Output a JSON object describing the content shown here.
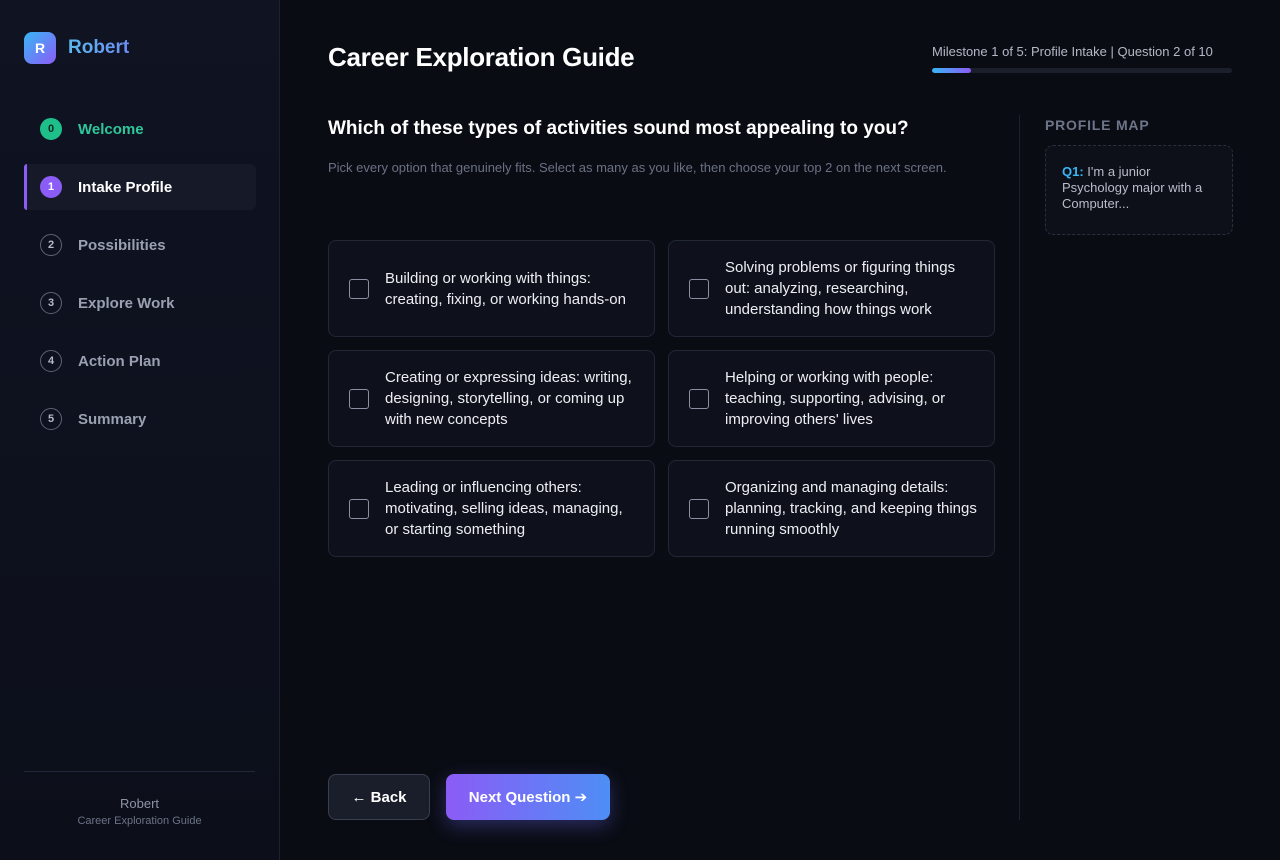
{
  "brand": {
    "logo_letter": "R",
    "name": "Robert"
  },
  "sidebar": {
    "items": [
      {
        "step": "0",
        "label": "Welcome",
        "state": "done"
      },
      {
        "step": "1",
        "label": "Intake Profile",
        "state": "active"
      },
      {
        "step": "2",
        "label": "Possibilities",
        "state": "pending"
      },
      {
        "step": "3",
        "label": "Explore Work",
        "state": "pending"
      },
      {
        "step": "4",
        "label": "Action Plan",
        "state": "pending"
      },
      {
        "step": "5",
        "label": "Summary",
        "state": "pending"
      }
    ],
    "footer": {
      "name": "Robert",
      "subtitle": "Career Exploration Guide"
    }
  },
  "header": {
    "title": "Career Exploration Guide",
    "progress_text": "Milestone 1 of 5: Profile Intake | Question 2 of 10",
    "progress_fraction": 0.13
  },
  "question": {
    "text": "Which of these types of activities sound most appealing to you?",
    "instructions": "Pick every option that genuinely fits. Select as many as you like, then choose your top 2 on the next screen.",
    "options": [
      {
        "label": "Building or working with things: creating, fixing, or working hands-on",
        "checked": false
      },
      {
        "label": "Solving problems or figuring things out: analyzing, researching, understanding how things work",
        "checked": false
      },
      {
        "label": "Creating or expressing ideas: writing, designing, storytelling, or coming up with new concepts",
        "checked": false
      },
      {
        "label": "Helping or working with people: teaching, supporting, advising, or improving others' lives",
        "checked": false
      },
      {
        "label": "Leading or influencing others: motivating, selling ideas, managing, or starting something",
        "checked": false
      },
      {
        "label": "Organizing and managing details: planning, tracking, and keeping things running smoothly",
        "checked": false
      }
    ]
  },
  "buttons": {
    "back": "← Back",
    "next": "Next Question ➔"
  },
  "profile_map": {
    "heading": "PROFILE MAP",
    "entries": [
      {
        "q": "Q1:",
        "answer": "I'm a junior Psychology major with a Computer..."
      }
    ]
  },
  "colors": {
    "accent_purple": "#8b5cf6",
    "accent_blue": "#38b6f5",
    "success_green": "#1fbf8a",
    "background": "#0a0c14"
  }
}
